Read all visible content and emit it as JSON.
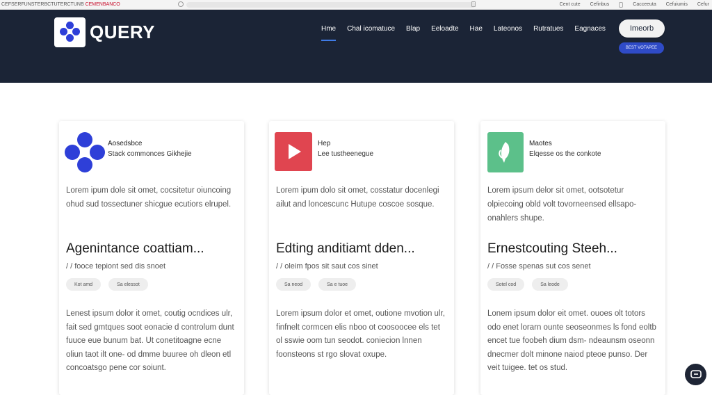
{
  "browser": {
    "left_text_a": "CEFSERFUNSTERBCTUTERCTUNB",
    "left_text_b": "CEMENBANCO",
    "links": [
      "Cent cute",
      "Cefinbus",
      "Cacceeuta",
      "Cefuiumis",
      "Cefur"
    ]
  },
  "header": {
    "logo_text": "QUERY",
    "nav": [
      {
        "label": "Hme",
        "active": true
      },
      {
        "label": "Chal icomatuce",
        "active": false
      },
      {
        "label": "Blap",
        "active": false
      },
      {
        "label": "Eeloadte",
        "active": false
      },
      {
        "label": "Hae",
        "active": false
      },
      {
        "label": "Lateonos",
        "active": false
      },
      {
        "label": "Rutratues",
        "active": false
      },
      {
        "label": "Eagnaces",
        "active": false
      }
    ],
    "signin_label": "Imeorb",
    "cta_label": "BEST VOTAPEE"
  },
  "cards": [
    {
      "category": "Aosedsbce",
      "subcategory": "Stack commonces Gikhejie",
      "intro": "Lorem ipum dole sit omet, cocsitetur oiuncoing ohud sud tossectuner shicgue ecutiors elrupel.",
      "title": "Agenintance coattiam...",
      "meta": "/ / fooce tepiont sed dis snoet",
      "tags": [
        "Kot amd",
        "Sa elessot"
      ],
      "body": "Lenest ipsum dolor it omet, coutig ocndices ulr, fait sed gmtques soot eonacie d controlum dunt fuuce eue bunum bat. Ut conetitoagne ecne oliun taot ilt one- od dmme buuree oh dleon etl concoatsgo pene cor soiunt."
    },
    {
      "category": "Hep",
      "subcategory": "Lee tustheenegue",
      "intro": "Lorem ipum dolo sit omet, cosstatur docenlegi ailut and loncescunc Hutupe coscoe sosque.",
      "title": "Edting anditiamt dden...",
      "meta": "/ / oleim fpos sit saut cos sinet",
      "tags": [
        "Sa neod",
        "Sa e tuoe"
      ],
      "body": "Lorem ipsum dolor et omet, outione mvotion ulr, finfnelt cormcen elis nboo ot coosoocee els tet ol sswie oom tun seodot. coniecion lnnen foonsteons st rgo slovat oxupe."
    },
    {
      "category": "Maotes",
      "subcategory": "Elqesse os the conkote",
      "intro": "Lorem ipsum delor sit omet, ootsotetur olpiecoing obld volt tovorneensed ellsapo-onahlers shupe.",
      "title": "Ernestcouting Steeh...",
      "meta": "/ / Fosse spenas sut cos senet",
      "tags": [
        "Sotel cod",
        "Sa leode"
      ],
      "body": "Lonem ipsum dolor eit omet. ouoes olt totors odo enet lorarn ounte seoseonmes ls fond eoltb encet tue foobeh dium dsm- ndeaunsm oseonn dnecmer dolt minone naiod pteoe punso. Der veit tuigee. tet os stud."
    }
  ]
}
